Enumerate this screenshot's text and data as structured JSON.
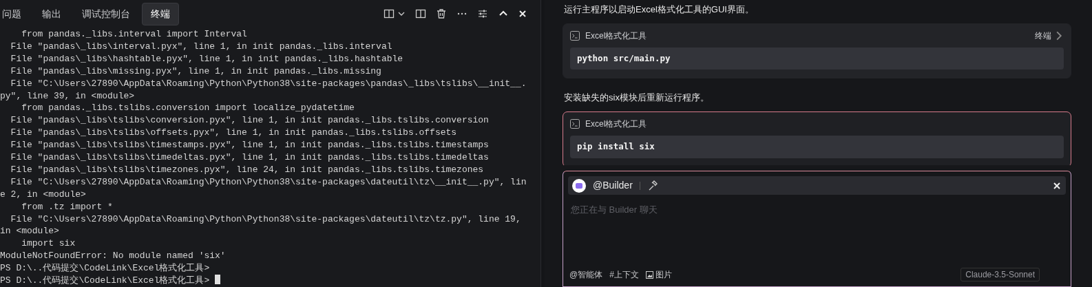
{
  "panel_tabs": [
    {
      "label": "问题",
      "selected": false
    },
    {
      "label": "输出",
      "selected": false
    },
    {
      "label": "调试控制台",
      "selected": false
    },
    {
      "label": "终端",
      "selected": true
    }
  ],
  "terminal": {
    "lines": [
      "    from pandas._libs.interval import Interval",
      "  File \"pandas\\_libs\\interval.pyx\", line 1, in init pandas._libs.interval",
      "  File \"pandas\\_libs\\hashtable.pyx\", line 1, in init pandas._libs.hashtable",
      "  File \"pandas\\_libs\\missing.pyx\", line 1, in init pandas._libs.missing",
      "  File \"C:\\Users\\27890\\AppData\\Roaming\\Python\\Python38\\site-packages\\pandas\\_libs\\tslibs\\__init__.",
      "py\", line 39, in <module>",
      "    from pandas._libs.tslibs.conversion import localize_pydatetime",
      "  File \"pandas\\_libs\\tslibs\\conversion.pyx\", line 1, in init pandas._libs.tslibs.conversion",
      "  File \"pandas\\_libs\\tslibs\\offsets.pyx\", line 1, in init pandas._libs.tslibs.offsets",
      "  File \"pandas\\_libs\\tslibs\\timestamps.pyx\", line 1, in init pandas._libs.tslibs.timestamps",
      "  File \"pandas\\_libs\\tslibs\\timedeltas.pyx\", line 1, in init pandas._libs.tslibs.timedeltas",
      "  File \"pandas\\_libs\\tslibs\\timezones.pyx\", line 24, in init pandas._libs.tslibs.timezones",
      "  File \"C:\\Users\\27890\\AppData\\Roaming\\Python\\Python38\\site-packages\\dateutil\\tz\\__init__.py\", lin",
      "e 2, in <module>",
      "    from .tz import *",
      "  File \"C:\\Users\\27890\\AppData\\Roaming\\Python\\Python38\\site-packages\\dateutil\\tz\\tz.py\", line 19,",
      "in <module>",
      "    import six",
      "ModuleNotFoundError: No module named 'six'",
      "PS D:\\..代码提交\\CodeLink\\Excel格式化工具>",
      "PS D:\\..代码提交\\CodeLink\\Excel格式化工具>"
    ]
  },
  "chat": [
    {
      "kind": "text",
      "text": "运行主程序以启动Excel格式化工具的GUI界面。"
    },
    {
      "kind": "code",
      "title": "Excel格式化工具",
      "action": "终端",
      "code": "python src/main.py",
      "highlighted": false
    },
    {
      "kind": "text",
      "text": "安装缺失的six模块后重新运行程序。"
    },
    {
      "kind": "code",
      "title": "Excel格式化工具",
      "code": "pip install six",
      "highlighted": true
    }
  ],
  "composer": {
    "mention": "@Builder",
    "placeholder": "您正在与 Builder 聊天",
    "tools": [
      "@智能体",
      "#上下文",
      "图片"
    ],
    "model": "Claude-3.5-Sonnet"
  }
}
